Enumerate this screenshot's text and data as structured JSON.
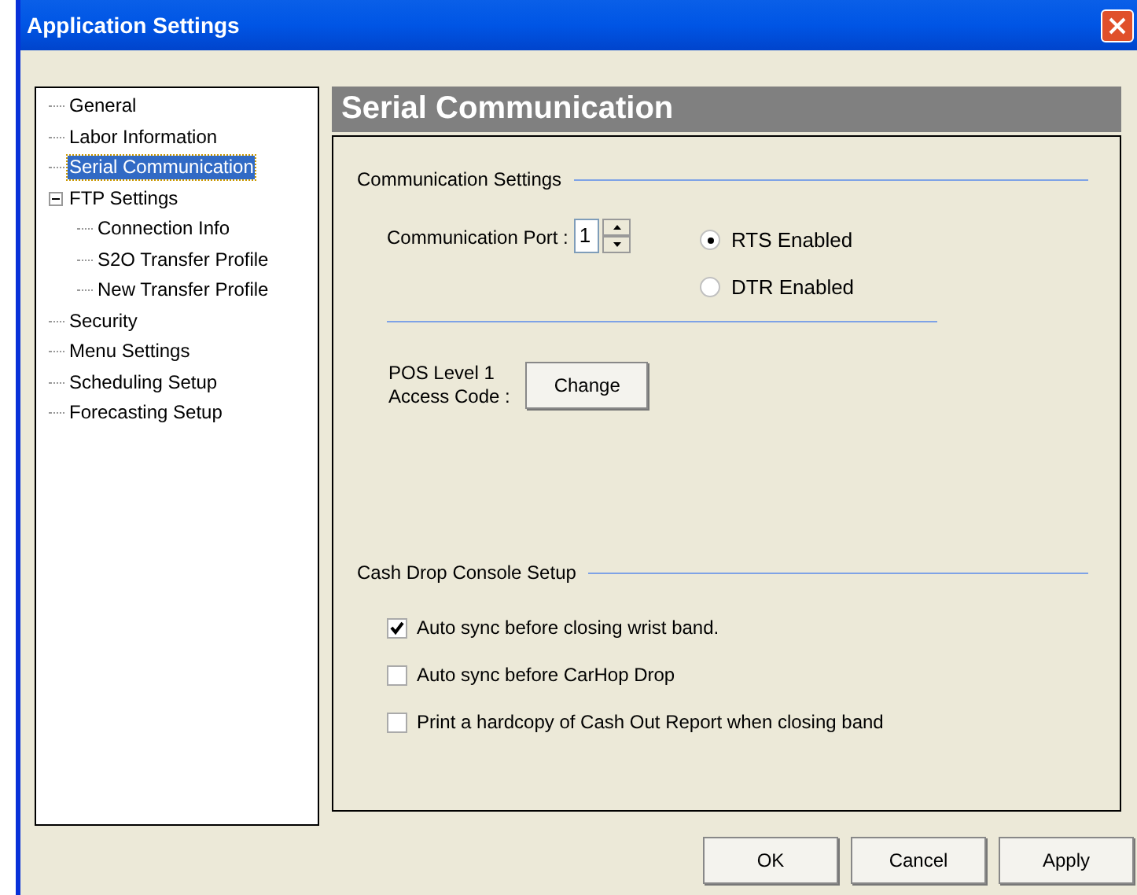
{
  "window": {
    "title": "Application Settings"
  },
  "tree": [
    {
      "label": "General",
      "selected": false
    },
    {
      "label": "Labor Information",
      "selected": false
    },
    {
      "label": "Serial Communication",
      "selected": true
    },
    {
      "label": "FTP Settings",
      "selected": false,
      "expanded": true,
      "children": [
        {
          "label": "Connection Info",
          "selected": false
        },
        {
          "label": "S2O Transfer Profile",
          "selected": false
        },
        {
          "label": "New Transfer Profile",
          "selected": false
        }
      ]
    },
    {
      "label": "Security",
      "selected": false
    },
    {
      "label": "Menu Settings",
      "selected": false
    },
    {
      "label": "Scheduling Setup",
      "selected": false
    },
    {
      "label": "Forecasting Setup",
      "selected": false
    }
  ],
  "page_title": "Serial Communication",
  "communication": {
    "heading": "Communication Settings",
    "port_label": "Communication Port :",
    "port_value": "1",
    "radios": [
      {
        "label": "RTS Enabled",
        "selected": true
      },
      {
        "label": "DTR Enabled",
        "selected": false
      }
    ],
    "access_label": "POS Level 1\nAccess Code :",
    "change_button": "Change"
  },
  "cash_drop": {
    "heading": "Cash Drop Console Setup",
    "options": [
      {
        "label": "Auto sync before closing wrist band.",
        "checked": true
      },
      {
        "label": "Auto sync before CarHop Drop",
        "checked": false
      },
      {
        "label": "Print a hardcopy of Cash Out Report when closing band",
        "checked": false
      }
    ]
  },
  "buttons": [
    "OK",
    "Cancel",
    "Apply"
  ]
}
